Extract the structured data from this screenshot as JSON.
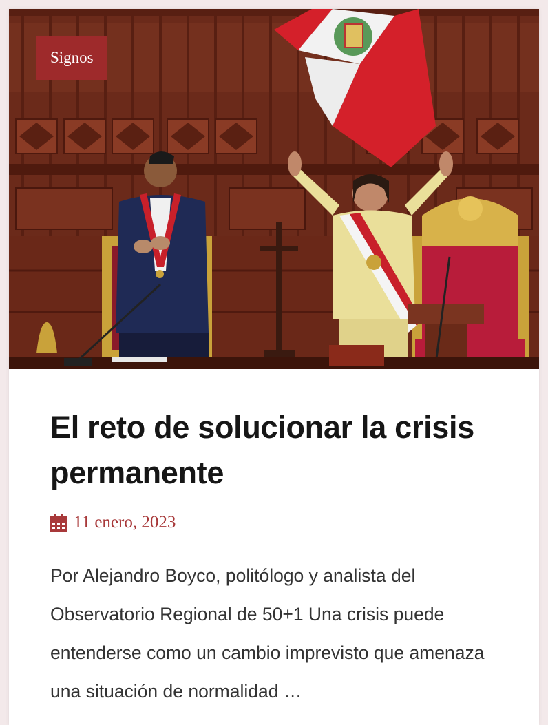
{
  "post": {
    "category": "Signos",
    "title": "El reto de solucionar la crisis permanente",
    "date": "11 enero, 2023",
    "excerpt": "Por Alejandro Boyco, politólogo y analista del Observatorio Regional de 50+1 Una crisis puede entenderse como un cambio imprevisto que amenaza una situación de normalidad …",
    "date_icon": "calendar-icon",
    "image_subject": "featured-photo"
  },
  "colors": {
    "accent": "#9e2a2b",
    "date": "#a8393a",
    "title": "#161616",
    "text": "#333333",
    "background": "#f3e9ea"
  }
}
